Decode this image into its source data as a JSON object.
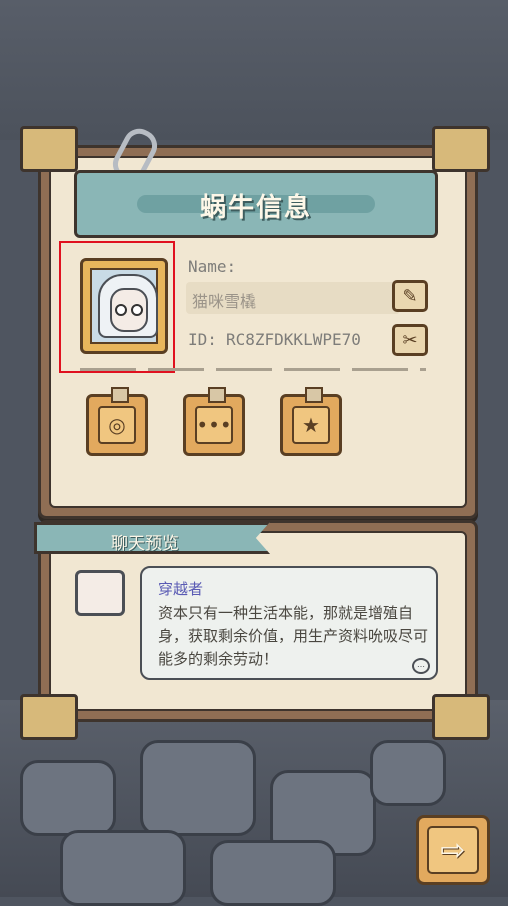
{
  "profile": {
    "title": "蜗牛信息",
    "name_label": "Name:",
    "name_value": "猫咪雪橇",
    "id_label": "ID:",
    "id_value": "RC8ZFDKKLWPE70"
  },
  "chat": {
    "tab_label": "聊天预览",
    "speaker": "穿越者",
    "message": "资本只有一种生活本能，那就是增殖自身，获取剩余价值，用生产资料吮吸尽可能多的剩余劳动！"
  },
  "buttons": {
    "more_glyph": "•••",
    "next_glyph": "⇨"
  },
  "colors": {
    "card_bg": "#f1e7d2",
    "banner": "#8ab6b6",
    "button_gold": "#e2a95e",
    "highlight": "#e0111f",
    "speaker": "#5a5bb4"
  },
  "icons": [
    "edit-name-icon",
    "copy-id-icon",
    "spiral-icon",
    "chat-bubble-icon",
    "star-badge-icon",
    "next-arrow-icon"
  ]
}
